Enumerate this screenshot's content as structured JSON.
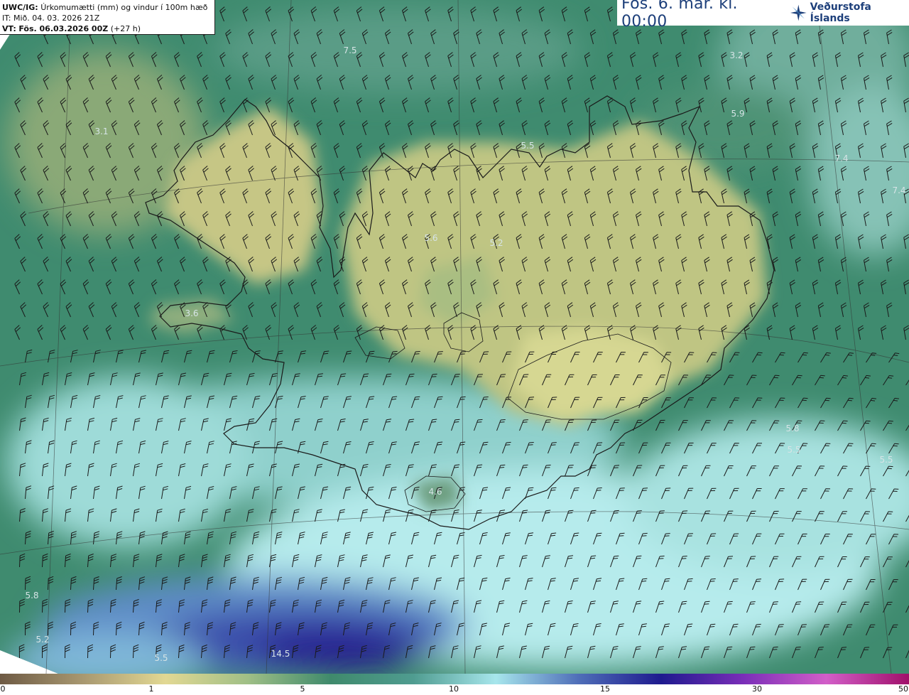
{
  "header": {
    "model_code": "UWC/IG:",
    "description": "Úrkomumætti (mm) og vindur í 100m hæð",
    "it_line": "IT: Mið. 04. 03. 2026 21Z",
    "vt_label": "VT:",
    "vt_value": "Fös. 06.03.2026 00Z",
    "vt_offset": "(+27 h)"
  },
  "title": {
    "forecast_time": "Fös. 6. mar. kl. 00:00",
    "brand": "Veðurstofa Íslands",
    "brand_icon": "snowflake-star-icon"
  },
  "value_labels": [
    "7.5",
    "3.2",
    "5.9",
    "3.1",
    "5.5",
    "7.4",
    "7.4",
    "5.6",
    "5.2",
    "3.6",
    "5.8",
    "5.5",
    "5.5",
    "4.6",
    "5.8",
    "5.2",
    "5.5",
    "14.5"
  ],
  "colorbar": {
    "ticks": [
      "0",
      "1",
      "5",
      "10",
      "15",
      "30",
      "50"
    ],
    "colors": [
      "#6e5a44",
      "#a89870",
      "#e2d893",
      "#9fbf86",
      "#3f8a6c",
      "#4f9c90",
      "#a7e6ec",
      "#4f6eb8",
      "#1e1a8e",
      "#7a2eb8",
      "#d25ec8",
      "#a0106a"
    ]
  },
  "colors": {
    "land": "#c9cb88",
    "sea_mid": "#3f8c70",
    "sea_light": "#a9e4e4",
    "heavy": "#2a2593",
    "coastline": "#1a1a1a",
    "title_text": "#1d3f7a"
  }
}
